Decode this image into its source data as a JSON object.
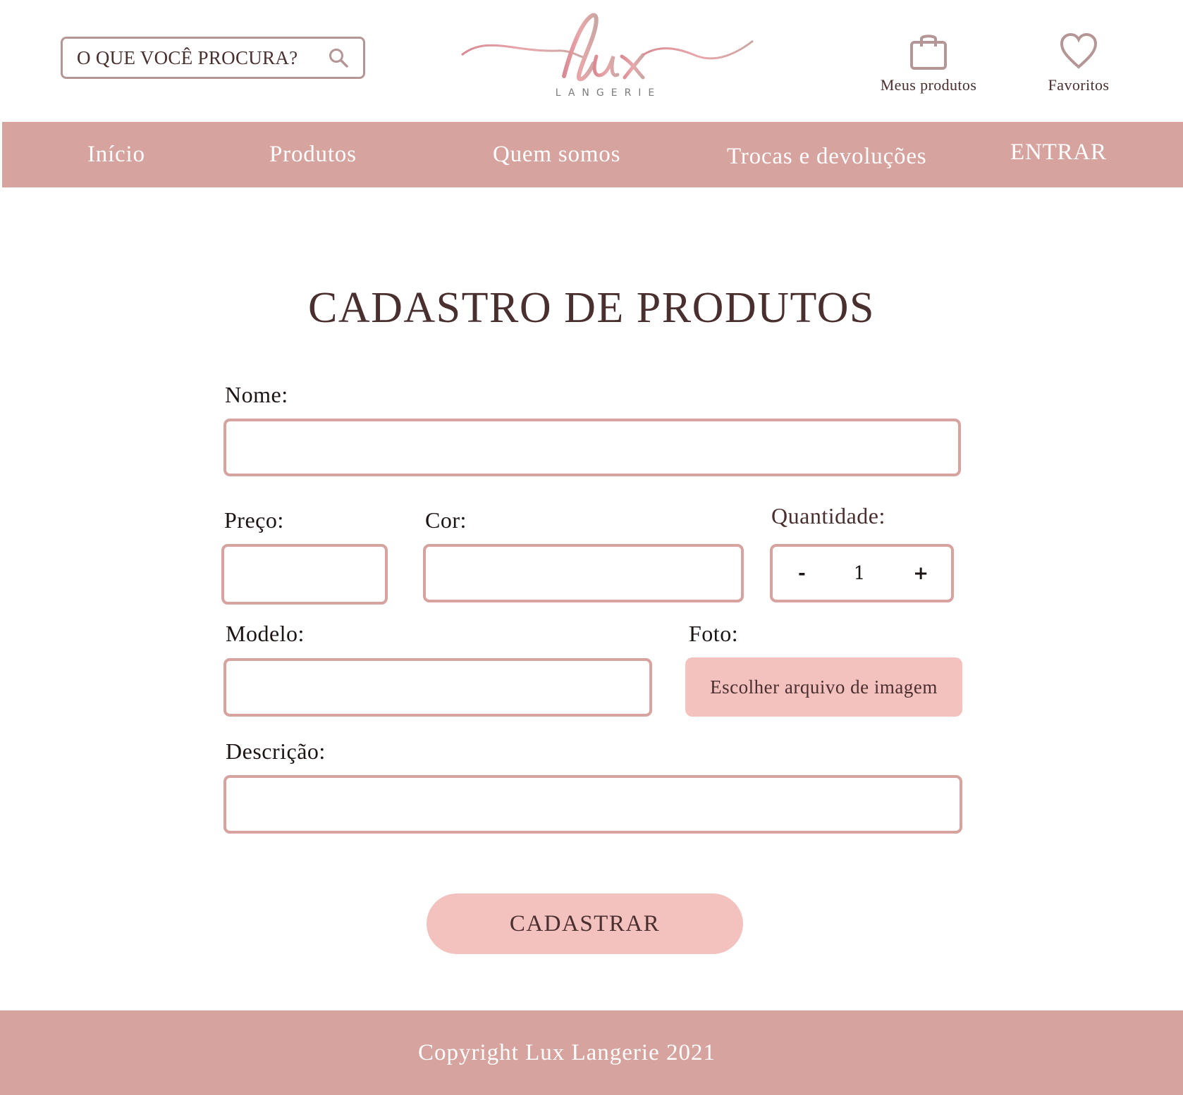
{
  "colors": {
    "accent": "#d7a39e",
    "button_fill": "#f3c2bf",
    "text_dark": "#4a2f2f",
    "logo_pink": "#e7a6a9"
  },
  "header": {
    "search": {
      "placeholder": "O QUE VOCÊ PROCURA?",
      "icon": "search-icon"
    },
    "logo": {
      "word": "lux",
      "subtitle": "LANGERIE"
    },
    "my_products": {
      "label": "Meus produtos",
      "icon": "shopping-bag-icon"
    },
    "favorites": {
      "label": "Favoritos",
      "icon": "heart-icon"
    }
  },
  "nav": {
    "items": [
      "Início",
      "Produtos",
      "Quem somos",
      "Trocas e devoluções",
      "ENTRAR"
    ]
  },
  "main": {
    "title": "CADASTRO DE PRODUTOS",
    "fields": {
      "nome": {
        "label": "Nome:",
        "value": ""
      },
      "preco": {
        "label": "Preço:",
        "value": ""
      },
      "cor": {
        "label": "Cor:",
        "value": ""
      },
      "quantidade": {
        "label": "Quantidade:",
        "minus": "-",
        "value": "1",
        "plus": "+"
      },
      "modelo": {
        "label": "Modelo:",
        "value": ""
      },
      "foto": {
        "label": "Foto:",
        "button": "Escolher arquivo de imagem"
      },
      "descricao": {
        "label": "Descrição:",
        "value": ""
      }
    },
    "submit": "CADASTRAR"
  },
  "footer": {
    "text": "Copyright Lux Langerie 2021"
  }
}
